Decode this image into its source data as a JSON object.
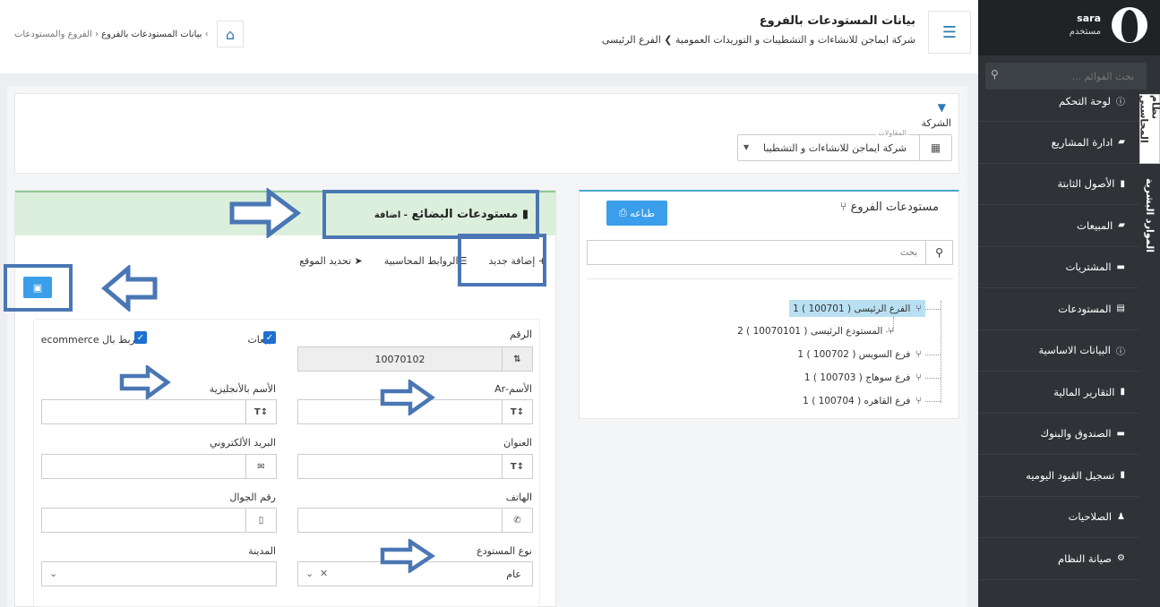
{
  "sidebar": {
    "user_name": "sara",
    "user_role": "مستخدم",
    "search_placeholder": "بحث القوائم ...",
    "items": [
      {
        "label": "لوحة التحكم",
        "icon": "info-icon"
      },
      {
        "label": "ادارة المشاريع",
        "icon": "handshake-icon"
      },
      {
        "label": "الأصول الثابتة",
        "icon": "file-icon"
      },
      {
        "label": "المبيعات",
        "icon": "truck-icon"
      },
      {
        "label": "المشتريات",
        "icon": "money-icon"
      },
      {
        "label": "المستودعات",
        "icon": "archive-icon"
      },
      {
        "label": "البيانات الاساسية",
        "icon": "info-icon"
      },
      {
        "label": "التقارير المالية",
        "icon": "file-icon"
      },
      {
        "label": "الصندوق والبنوك",
        "icon": "money-icon"
      },
      {
        "label": "تسجيل القيود اليوميه",
        "icon": "file-icon"
      },
      {
        "label": "الصلاحيات",
        "icon": "users-icon"
      },
      {
        "label": "صيانة النظام",
        "icon": "gear-icon"
      }
    ],
    "vertical_tabs": [
      "نظام المحاسبي",
      "الموارد البشرية"
    ]
  },
  "header": {
    "title": "بيانات المستودعات بالفروع",
    "company": "شركة ايماجن للانشاءات و التشطيبات و التوريدات العمومية",
    "branch": "الفرع الرئيسى",
    "breadcrumb": [
      "الفروع والمستودعات",
      "بيانات المستودعات بالفروع"
    ]
  },
  "filter": {
    "label": "الشركة",
    "field_label": "المقاولات",
    "value": "شركة ايماجن للانشاءات و التشطيبات"
  },
  "branches": {
    "title": "مستودعات الفروع",
    "print_label": "طباعه",
    "search_placeholder": "بحث",
    "tree": [
      {
        "label": "الفرع الرئيسى ( 100701 ) 1",
        "selected": true
      },
      {
        "label": "المستودع الرئيسى ( 10070101 ) 2",
        "selected": false
      },
      {
        "label": "فرع السويس ( 100702 ) 1",
        "selected": false
      },
      {
        "label": "فرع سوهاج ( 100703 ) 1",
        "selected": false
      },
      {
        "label": "فرع القاهره ( 100704 ) 1",
        "selected": false
      }
    ]
  },
  "form": {
    "title": "مستودعات البضائع",
    "mode": "- اضافة",
    "tabs": [
      "+ إضافة جديد",
      "الروابط المحاسبية",
      "تحديد الموقع"
    ],
    "fields": {
      "number_label": "الرقم",
      "number_value": "10070102",
      "sales_label": "مبيعات",
      "ecommerce_label": "الربط بال ecommerce",
      "name_ar_label": "الأسم-Ar",
      "name_en_label": "الأسم بالأنجليزية",
      "address_label": "العنوان",
      "email_label": "البريد الألكتروني",
      "phone_label": "الهاتف",
      "mobile_label": "رقم الجوال",
      "type_label": "نوع المستودع",
      "type_value": "عام",
      "city_label": "المدينة"
    }
  },
  "colors": {
    "accent": "#3b9eea",
    "sidebar": "#2f3337",
    "annotation": "#4a77b4",
    "form_header": "#dcefdc"
  }
}
